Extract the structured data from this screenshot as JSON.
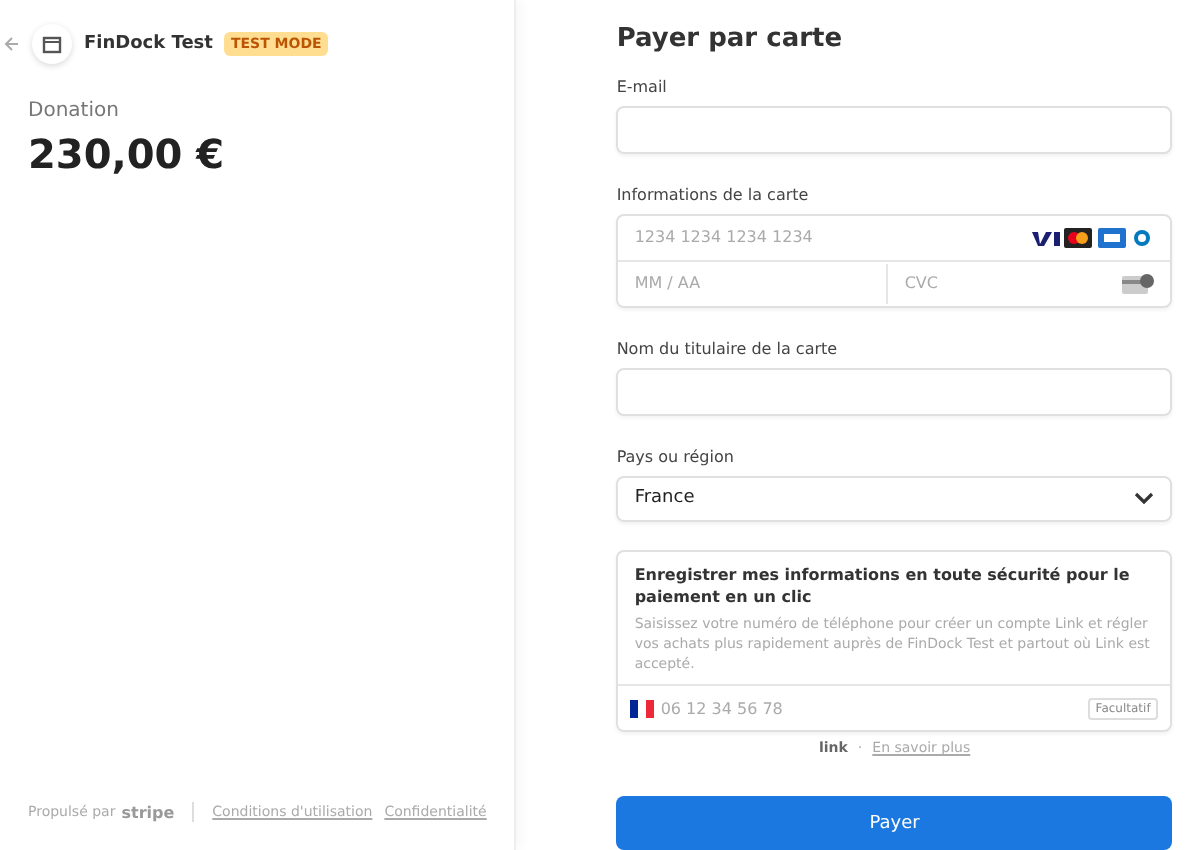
{
  "merchant": {
    "name": "FinDock Test",
    "badge": "TEST MODE"
  },
  "summary": {
    "label": "Donation",
    "amount": "230,00 €"
  },
  "footer": {
    "powered": "Propulsé par",
    "brand": "stripe",
    "links": [
      "Conditions d'utilisation",
      "Confidentialité"
    ]
  },
  "form": {
    "title": "Payer par carte",
    "fields": [
      {
        "kind": "input",
        "label": "E-mail"
      },
      {
        "kind": "card",
        "label": "Informations de la carte",
        "number_placeholder": "1234 1234 1234 1234",
        "expiry_placeholder": "MM / AA",
        "cvc_placeholder": "CVC"
      },
      {
        "kind": "input",
        "label": "Nom du titulaire de la carte"
      },
      {
        "kind": "select",
        "label": "Pays ou région",
        "value": "France"
      }
    ],
    "link_box": {
      "title": "Enregistrer mes informations en toute sécurité pour le paiement en un clic",
      "text": "Saisissez votre numéro de téléphone pour créer un compte Link et régler vos achats plus rapidement auprès de FinDock Test et partout où Link est accepté.",
      "phone_placeholder": "06 12 34 56 78",
      "optional": "Facultatif"
    },
    "link_row": {
      "brand": "link",
      "separator": "·",
      "more": "En savoir plus"
    },
    "submit": "Payer"
  }
}
